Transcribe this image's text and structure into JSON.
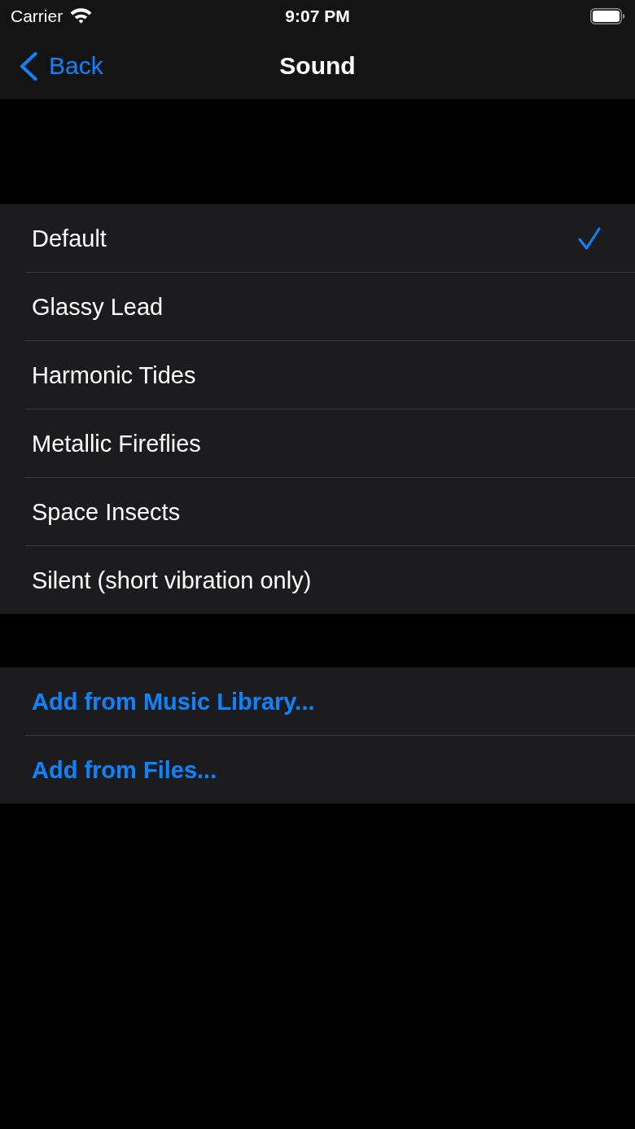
{
  "status_bar": {
    "carrier": "Carrier",
    "time": "9:07 PM"
  },
  "nav_bar": {
    "back_label": "Back",
    "title": "Sound"
  },
  "sounds": [
    {
      "label": "Default",
      "selected": true
    },
    {
      "label": "Glassy Lead",
      "selected": false
    },
    {
      "label": "Harmonic Tides",
      "selected": false
    },
    {
      "label": "Metallic Fireflies",
      "selected": false
    },
    {
      "label": "Space Insects",
      "selected": false
    },
    {
      "label": "Silent (short vibration only)",
      "selected": false
    }
  ],
  "actions": [
    {
      "label": "Add from Music Library..."
    },
    {
      "label": "Add from Files..."
    }
  ]
}
